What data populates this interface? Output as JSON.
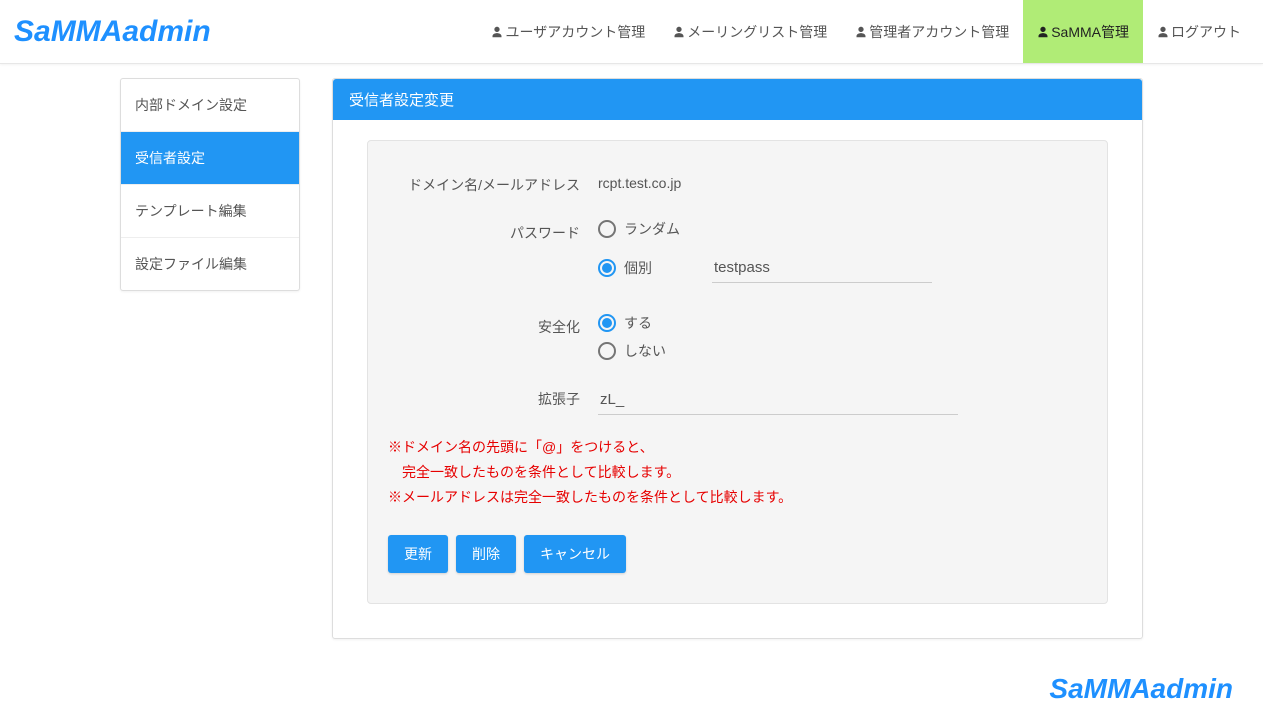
{
  "brand": "SaMMAadmin",
  "nav": [
    {
      "label": "ユーザアカウント管理",
      "active": false
    },
    {
      "label": "メーリングリスト管理",
      "active": false
    },
    {
      "label": "管理者アカウント管理",
      "active": false
    },
    {
      "label": "SaMMA管理",
      "active": true
    },
    {
      "label": "ログアウト",
      "active": false
    }
  ],
  "sidebar": [
    {
      "label": "内部ドメイン設定",
      "active": false
    },
    {
      "label": "受信者設定",
      "active": true
    },
    {
      "label": "テンプレート編集",
      "active": false
    },
    {
      "label": "設定ファイル編集",
      "active": false
    }
  ],
  "panel": {
    "title": "受信者設定変更",
    "domain_label": "ドメイン名/メールアドレス",
    "domain_value": "rcpt.test.co.jp",
    "password_label": "パスワード",
    "password_random": "ランダム",
    "password_individual": "個別",
    "password_value": "testpass",
    "safety_label": "安全化",
    "safety_yes": "する",
    "safety_no": "しない",
    "ext_label": "拡張子",
    "ext_value": "zL_",
    "note1": "※ドメイン名の先頭に「@」をつけると、",
    "note2": "　完全一致したものを条件として比較します。",
    "note3": "※メールアドレスは完全一致したものを条件として比較します。",
    "btn_update": "更新",
    "btn_delete": "削除",
    "btn_cancel": "キャンセル"
  },
  "footer_brand": "SaMMAadmin"
}
